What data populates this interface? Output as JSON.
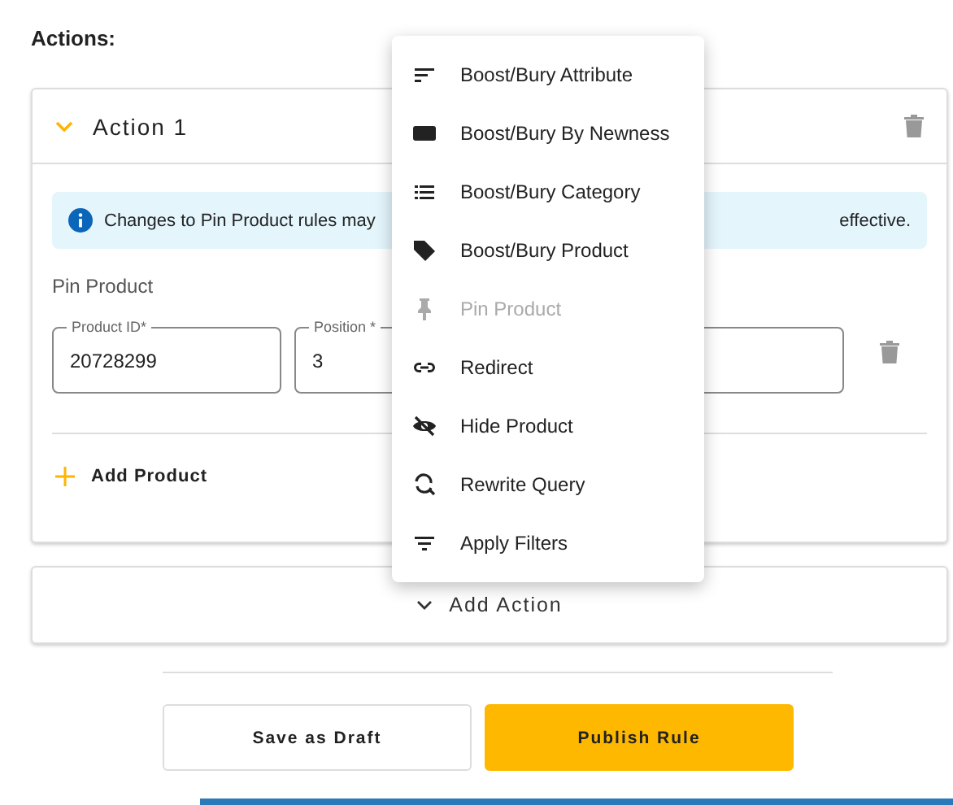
{
  "section_title": "Actions:",
  "action": {
    "title": "Action 1",
    "expanded": true,
    "info": {
      "text_start": "Changes to Pin Product rules may",
      "text_end": "effective."
    },
    "group_label": "Pin Product",
    "fields": [
      {
        "label": "Product ID*",
        "value": "20728299"
      },
      {
        "label": "Position *",
        "value": "3"
      }
    ],
    "add_label": "Add Product"
  },
  "menu": [
    {
      "kind": "sort",
      "label": "Boost/Bury Attribute",
      "disabled": false
    },
    {
      "kind": "new",
      "label": "Boost/Bury By Newness",
      "disabled": false
    },
    {
      "kind": "list",
      "label": "Boost/Bury Category",
      "disabled": false
    },
    {
      "kind": "tag",
      "label": "Boost/Bury Product",
      "disabled": false
    },
    {
      "kind": "pin",
      "label": "Pin Product",
      "disabled": true
    },
    {
      "kind": "link",
      "label": "Redirect",
      "disabled": false
    },
    {
      "kind": "hide",
      "label": "Hide Product",
      "disabled": false
    },
    {
      "kind": "rewrite",
      "label": "Rewrite Query",
      "disabled": false
    },
    {
      "kind": "filter",
      "label": "Apply Filters",
      "disabled": false
    }
  ],
  "add_action": "Add Action",
  "buttons": [
    {
      "kind": "secondary",
      "label": "Save as Draft"
    },
    {
      "kind": "primary",
      "label": "Publish Rule"
    }
  ]
}
